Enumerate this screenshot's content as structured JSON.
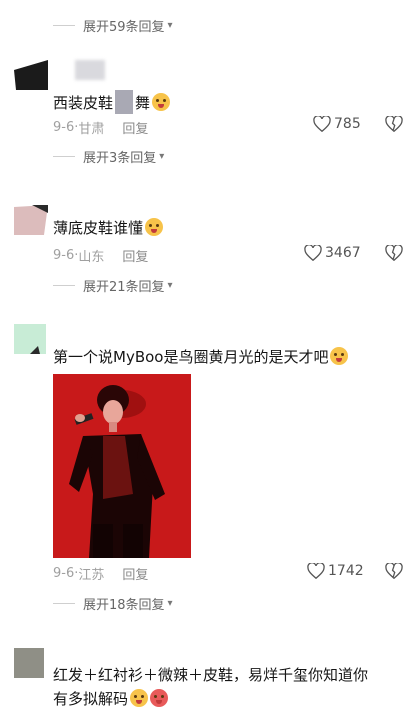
{
  "top_expand": {
    "label": "展开59条回复"
  },
  "comments": [
    {
      "text_a": "西装皮鞋",
      "text_b": "舞",
      "date": "9-6",
      "location": "甘肃",
      "reply": "回复",
      "likes": "785"
    },
    {
      "text": "薄底皮鞋谁懂",
      "date": "9-6",
      "location": "山东",
      "reply": "回复",
      "likes": "3467",
      "expand": "展开21条回复"
    },
    {
      "text": "第一个说MyBoo是鸟圈黄月光的是天才吧",
      "date": "9-6",
      "location": "江苏",
      "reply": "回复",
      "likes": "1742",
      "expand": "展开18条回复"
    },
    {
      "text_line1": "红发＋红衬衫＋微辣＋皮鞋，易烊千玺你知道你",
      "text_line2": "有多拟解码"
    }
  ],
  "comment1_expand": "展开3条回复",
  "meta_separator": "·",
  "icons": {
    "like": "heart-icon",
    "dislike": "broken-heart-icon",
    "expand": "chevron-down-icon"
  }
}
